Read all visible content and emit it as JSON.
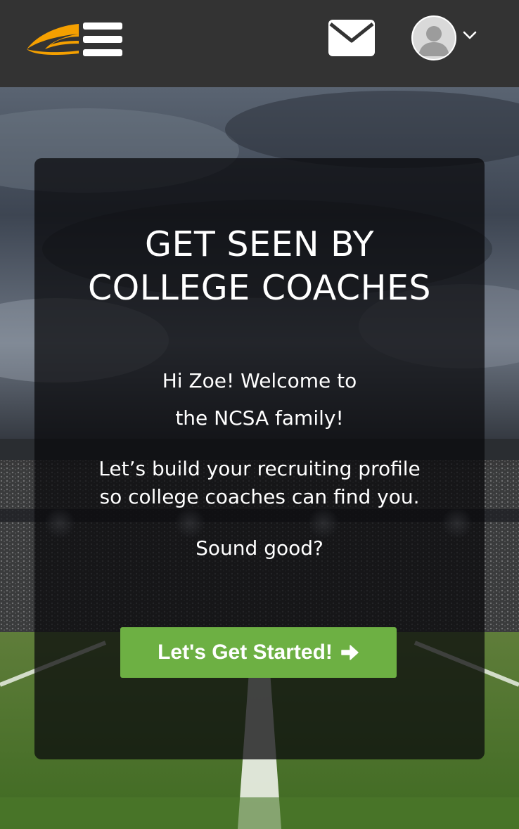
{
  "header": {
    "logo_icon": "ncsa-swoosh-logo",
    "menu_icon": "hamburger-menu-icon",
    "messages_icon": "envelope-icon",
    "profile_icon": "user-avatar",
    "profile_menu_icon": "chevron-down-icon",
    "colors": {
      "bar": "#333333",
      "logo": "#f5a000",
      "icons": "#ffffff"
    }
  },
  "card": {
    "headline": [
      "GET SEEN BY",
      "COLLEGE COACHES"
    ],
    "welcome": [
      "Hi Zoe! Welcome to",
      "the NCSA family!"
    ],
    "pitch": [
      "Let’s build your recruiting profile",
      "so college coaches can find you."
    ],
    "question": "Sound good?",
    "cta_label": "Let's Get Started!",
    "cta_icon": "arrow-right-icon",
    "cta_color": "#6db043"
  },
  "background": {
    "scene": "stadium-football-field",
    "field_marking": "50"
  }
}
